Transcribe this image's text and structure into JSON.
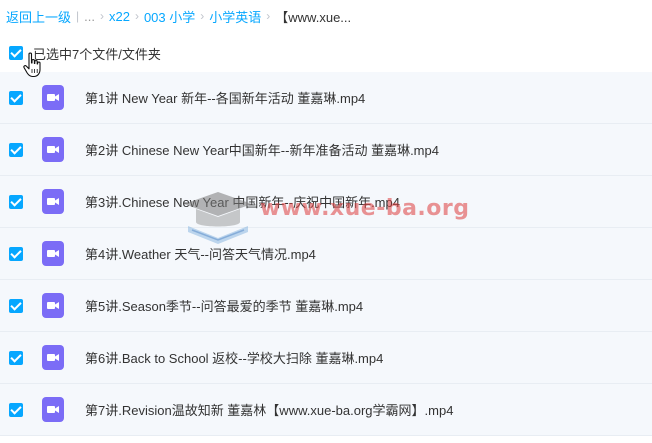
{
  "breadcrumb": {
    "back": "返回上一级",
    "ellipsis": "...",
    "items": [
      "x22",
      "003 小学",
      "小学英语"
    ],
    "current": "【www.xue..."
  },
  "selection": {
    "label": "已选中7个文件/文件夹",
    "checked": true
  },
  "files": [
    {
      "name": "第1讲 New Year 新年--各国新年活动 董嘉琳.mp4",
      "checked": true
    },
    {
      "name": "第2讲 Chinese New Year中国新年--新年准备活动 董嘉琳.mp4",
      "checked": true
    },
    {
      "name": "第3讲.Chinese New Year 中国新年--庆祝中国新年.mp4",
      "checked": true
    },
    {
      "name": "第4讲.Weather 天气--问答天气情况.mp4",
      "checked": true
    },
    {
      "name": "第5讲.Season季节--问答最爱的季节 董嘉琳.mp4",
      "checked": true
    },
    {
      "name": "第6讲.Back to School 返校--学校大扫除 董嘉琳.mp4",
      "checked": true
    },
    {
      "name": "第7讲.Revision温故知新 董嘉林【www.xue-ba.org学霸网】.mp4",
      "checked": true
    }
  ],
  "watermark": {
    "text": "www.xue-ba.org"
  },
  "colors": {
    "accent": "#06a7ff",
    "video_icon": "#7b6cf6",
    "row_bg": "#f5f8fc"
  }
}
